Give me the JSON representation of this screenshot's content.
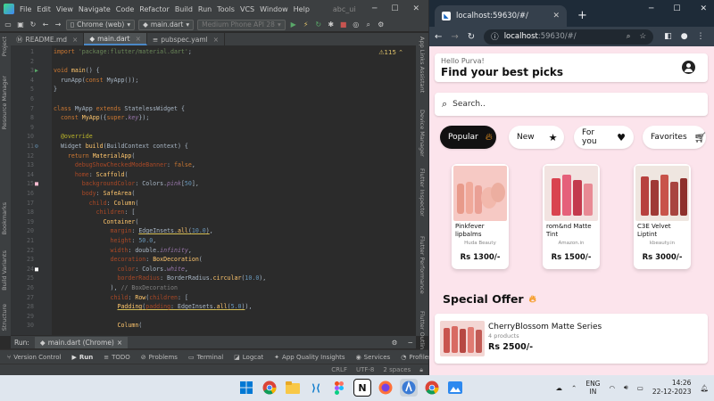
{
  "ide": {
    "menu": [
      "File",
      "Edit",
      "View",
      "Navigate",
      "Code",
      "Refactor",
      "Build",
      "Run",
      "Tools",
      "VCS",
      "Window",
      "Help"
    ],
    "project": "abc_ui",
    "toolbar": {
      "device": "Chrome (web)",
      "run_config": "main.dart",
      "emulator": "Medium Phone API 28"
    },
    "tabs": [
      {
        "label": "README.md"
      },
      {
        "label": "main.dart"
      },
      {
        "label": "pubspec.yaml"
      }
    ],
    "warning_count": "115",
    "left_panels": [
      "Project",
      "Resource Manager",
      "Bookmarks",
      "Build Variants",
      "Structure"
    ],
    "right_panels": [
      "App Links Assistant",
      "Device Manager",
      "Flutter Inspector",
      "Flutter Performance",
      "Flutter Outline"
    ],
    "line_numbers": [
      "1",
      "2",
      "3",
      "4",
      "5",
      "6",
      "7",
      "8",
      "9",
      "10",
      "11",
      "12",
      "13",
      "14",
      "15",
      "16",
      "17",
      "18",
      "19",
      "20",
      "21",
      "22",
      "23",
      "24",
      "25",
      "26",
      "27",
      "28",
      "29",
      "30"
    ],
    "run_bar": {
      "label": "Run:",
      "config": "main.dart (Chrome)"
    },
    "bottom_tools": [
      "Version Control",
      "Run",
      "TODO",
      "Problems",
      "Terminal",
      "Logcat",
      "App Quality Insights",
      "Services",
      "Profiler"
    ],
    "status": {
      "line_sep": "CRLF",
      "encoding": "UTF-8",
      "indent": "2 spaces"
    }
  },
  "browser": {
    "tab_title": "localhost:59630/#/",
    "url_host": "localhost",
    "url_path": ":59630/#/"
  },
  "app": {
    "greeting": "Hello Purva!",
    "headline": "Find your best picks",
    "search_placeholder": "Search..",
    "categories": [
      {
        "label": "Popular",
        "icon": "fire-icon",
        "selected": true
      },
      {
        "label": "New",
        "icon": "star-icon",
        "selected": false
      },
      {
        "label": "For you",
        "icon": "heart-icon",
        "selected": false
      },
      {
        "label": "Favorites",
        "icon": "cart-icon",
        "selected": false
      }
    ],
    "products": [
      {
        "name": "Pinkfever lipbalms",
        "brand": "Huda Beauty",
        "price": "Rs 1300/-"
      },
      {
        "name": "rom&nd Matte Tint",
        "brand": "Amazon.in",
        "price": "Rs 1500/-"
      },
      {
        "name": "C3E Velvet Liptint",
        "brand": "kbeauty.in",
        "price": "Rs 3000/-"
      }
    ],
    "special_offer_title": "Special Offer",
    "offer": {
      "name": "CherryBlossom Matte Series",
      "count": "4 products",
      "price": "Rs 2500/-"
    }
  },
  "taskbar": {
    "lang_top": "ENG",
    "lang_bottom": "IN",
    "time": "14:26",
    "date": "22-12-2023"
  },
  "colors": {
    "ide_bg": "#2b2b2b",
    "app_bg": "#fce4ec",
    "chip_selected": "#111111",
    "fire": "#f59b23"
  }
}
